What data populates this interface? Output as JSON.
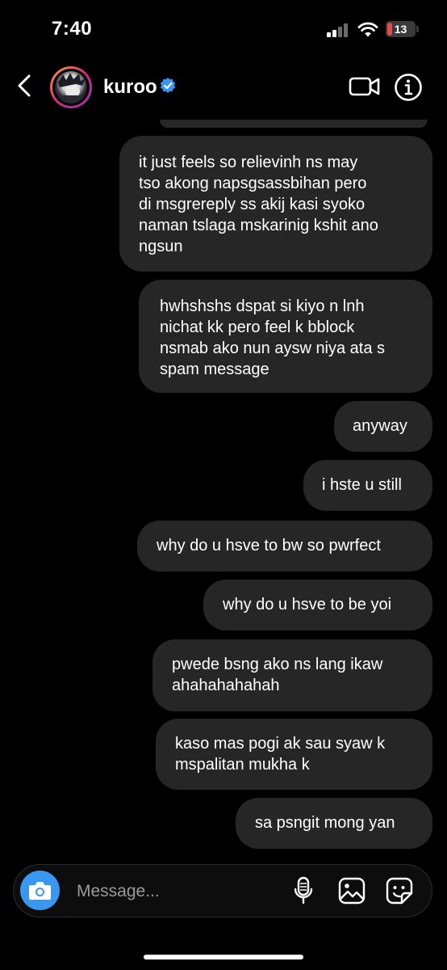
{
  "status_bar": {
    "time": "7:40",
    "battery_level": "13",
    "battery_color": "#e5484d"
  },
  "header": {
    "username": "kuroo",
    "verified": true,
    "back_icon": "chevron-left-icon",
    "video_icon": "video-camera-icon",
    "info_icon": "info-icon"
  },
  "messages": [
    {
      "sender": "me",
      "text": "it just feels so relievinh ns may\ntso akong napsgsassbihan pero\ndi msgrereply ss akij kasi syoko\nnaman tslaga mskarinig kshit ano\nngsun"
    },
    {
      "sender": "me",
      "text": "hwhshshs dspat si kiyo n lnh\nnichat kk pero feel k bblock\nnsmab ako nun aysw niya ata s\nspam message"
    },
    {
      "sender": "me",
      "text": "anyway"
    },
    {
      "sender": "me",
      "text": "i hste u still"
    },
    {
      "sender": "me",
      "text": "why do u hsve to bw so pwrfect"
    },
    {
      "sender": "me",
      "text": "why do u hsve to be yoi"
    },
    {
      "sender": "me",
      "text": "pwede bsng ako ns lang ikaw\nahahahahahah"
    },
    {
      "sender": "me",
      "text": "kaso mas pogi ak sau syaw k\nmspalitan mukha k"
    },
    {
      "sender": "me",
      "text": "sa psngit mong yan"
    }
  ],
  "composer": {
    "placeholder": "Message...",
    "camera_icon": "camera-icon",
    "mic_icon": "microphone-icon",
    "gallery_icon": "image-gallery-icon",
    "sticker_icon": "sticker-icon",
    "accent_color": "#3897f0"
  },
  "theme": {
    "background": "#000000",
    "bubble_color": "#262626",
    "verified_color": "#3897f0"
  }
}
